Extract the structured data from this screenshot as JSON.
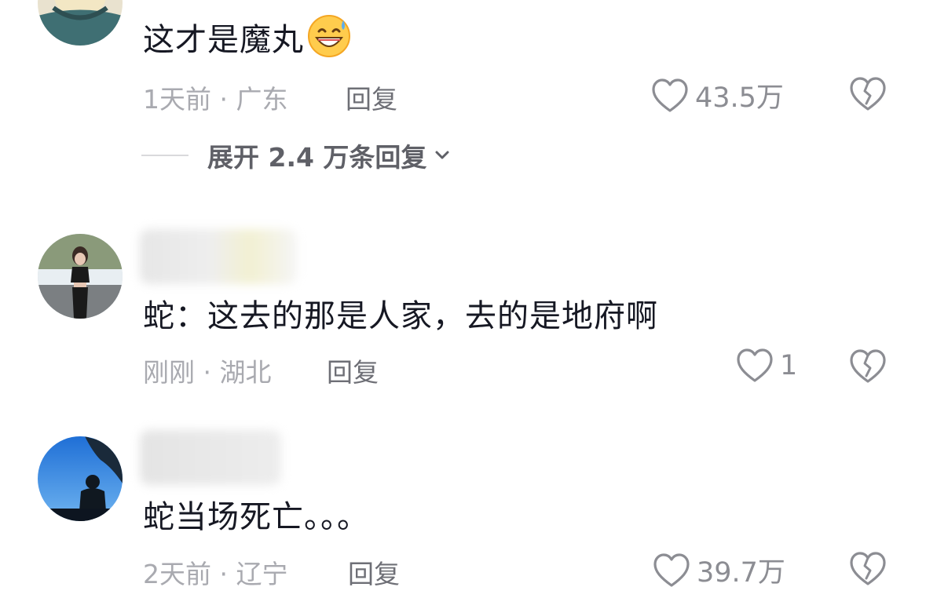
{
  "comments": [
    {
      "text": "这才是魔丸",
      "emoji": "grinning-sweat-emoji",
      "time_location": "1天前 · 广东",
      "reply_label": "回复",
      "likes": "43.5万",
      "expand_label": "展开 2.4 万条回复"
    },
    {
      "text": "蛇：这去的那是人家，去的是地府啊",
      "time_location": "刚刚 · 湖北",
      "reply_label": "回复",
      "likes": "1"
    },
    {
      "text": "蛇当场死亡。。。",
      "time_location": "2天前 · 辽宁",
      "reply_label": "回复",
      "likes": "39.7万"
    }
  ],
  "icons": {
    "like": "heart-outline-icon",
    "dislike": "broken-heart-icon",
    "expand": "chevron-down-icon"
  },
  "colors": {
    "text": "#161823",
    "meta": "#a9aab0",
    "reply": "#6e6f76",
    "icon": "#8c8d93"
  }
}
